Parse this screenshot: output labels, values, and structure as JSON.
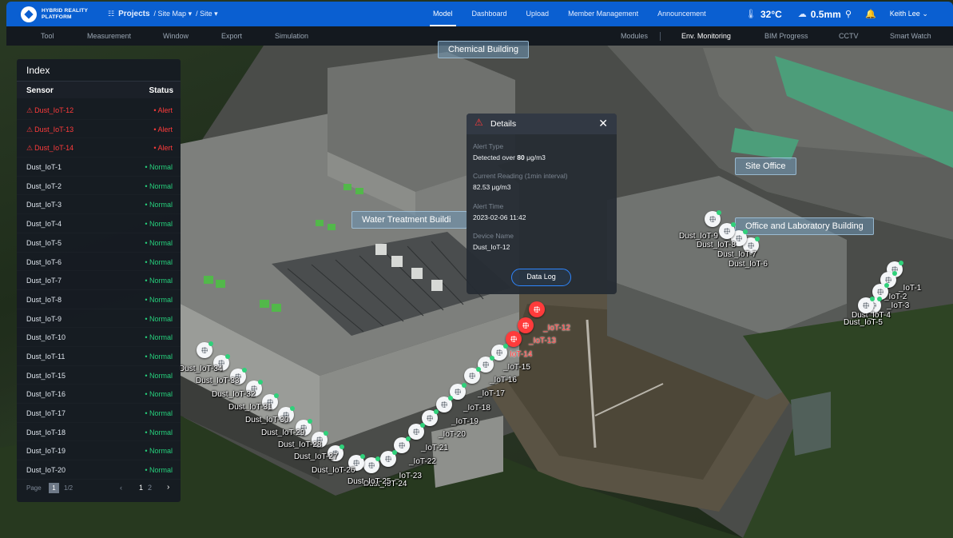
{
  "app": {
    "logo_line1": "HYBRID REALITY",
    "logo_line2": "PLATFORM",
    "logo_icon": "diamond-logo-icon"
  },
  "breadcrumb": {
    "projects": "Projects",
    "projects_icon": "grid-icon",
    "site_map": "/ Site Map ▾",
    "site": "/ Site ▾"
  },
  "topnav": [
    {
      "label": "Model",
      "active": true
    },
    {
      "label": "Dashboard",
      "active": false
    },
    {
      "label": "Upload",
      "active": false
    },
    {
      "label": "Member Management",
      "active": false
    },
    {
      "label": "Announcement",
      "active": false
    }
  ],
  "weather": {
    "temperature": "32°C",
    "temperature_icon": "thermometer-icon",
    "rainfall": "0.5mm",
    "rainfall_icon": "cloud-rain-icon"
  },
  "user": {
    "name": "Keith Lee",
    "search_icon": "search-icon",
    "bell_icon": "bell-icon",
    "chevron_icon": "chevron-down-icon"
  },
  "toolbar": {
    "left": [
      "Tool",
      "Measurement",
      "Window",
      "Export",
      "Simulation"
    ],
    "right": [
      {
        "label": "Modules",
        "active": false
      },
      {
        "label": "Env. Monitoring",
        "active": true
      },
      {
        "label": "BIM Progress",
        "active": false
      },
      {
        "label": "CCTV",
        "active": false
      },
      {
        "label": "Smart Watch",
        "active": false
      }
    ]
  },
  "index_panel": {
    "title": "Index",
    "col_sensor": "Sensor",
    "col_status": "Status",
    "rows": [
      {
        "sensor": "Dust_IoT-12",
        "status": "Alert",
        "alert": true
      },
      {
        "sensor": "Dust_IoT-13",
        "status": "Alert",
        "alert": true
      },
      {
        "sensor": "Dust_IoT-14",
        "status": "Alert",
        "alert": true
      },
      {
        "sensor": "Dust_IoT-1",
        "status": "Normal",
        "alert": false
      },
      {
        "sensor": "Dust_IoT-2",
        "status": "Normal",
        "alert": false
      },
      {
        "sensor": "Dust_IoT-3",
        "status": "Normal",
        "alert": false
      },
      {
        "sensor": "Dust_IoT-4",
        "status": "Normal",
        "alert": false
      },
      {
        "sensor": "Dust_IoT-5",
        "status": "Normal",
        "alert": false
      },
      {
        "sensor": "Dust_IoT-6",
        "status": "Normal",
        "alert": false
      },
      {
        "sensor": "Dust_IoT-7",
        "status": "Normal",
        "alert": false
      },
      {
        "sensor": "Dust_IoT-8",
        "status": "Normal",
        "alert": false
      },
      {
        "sensor": "Dust_IoT-9",
        "status": "Normal",
        "alert": false
      },
      {
        "sensor": "Dust_IoT-10",
        "status": "Normal",
        "alert": false
      },
      {
        "sensor": "Dust_IoT-11",
        "status": "Normal",
        "alert": false
      },
      {
        "sensor": "Dust_IoT-15",
        "status": "Normal",
        "alert": false
      },
      {
        "sensor": "Dust_IoT-16",
        "status": "Normal",
        "alert": false
      },
      {
        "sensor": "Dust_IoT-17",
        "status": "Normal",
        "alert": false
      },
      {
        "sensor": "Dust_IoT-18",
        "status": "Normal",
        "alert": false
      },
      {
        "sensor": "Dust_IoT-19",
        "status": "Normal",
        "alert": false
      },
      {
        "sensor": "Dust_IoT-20",
        "status": "Normal",
        "alert": false
      }
    ],
    "pager": {
      "label": "Page",
      "current": "1",
      "total": "1/2",
      "prev": "‹",
      "page1": "1",
      "page2": "2",
      "next": "›"
    }
  },
  "buildings": {
    "chemical": "Chemical Building",
    "water": "Water Treatment Buildi",
    "site_office": "Site Office",
    "office_lab": "Office and Laboratory Building"
  },
  "details": {
    "title": "Details",
    "warn_icon": "warning-triangle-icon",
    "close_icon": "close-icon",
    "alert_type_label": "Alert Type",
    "alert_type_prefix": "Detected over ",
    "alert_type_value": "80",
    "alert_type_unit": " μg/m3",
    "reading_label": "Current Reading (1min interval)",
    "reading_value": "82.53 μg/m3",
    "time_label": "Alert Time",
    "time_value": "2023-02-06 11:42",
    "device_label": "Device Name",
    "device_value": "Dust_IoT-12",
    "button": "Data Log"
  },
  "map_sensors": [
    {
      "label": "_IoT-12",
      "alert": true
    },
    {
      "label": "_IoT-13",
      "alert": true
    },
    {
      "label": "IoT-14",
      "alert": true
    },
    {
      "label": "_IoT-15",
      "alert": false
    },
    {
      "label": "_IoT-16",
      "alert": false
    },
    {
      "label": "_IoT-17",
      "alert": false
    },
    {
      "label": "_IoT-18",
      "alert": false
    },
    {
      "label": "_IoT-19",
      "alert": false
    },
    {
      "label": "_IoT-20",
      "alert": false
    },
    {
      "label": "_IoT-21",
      "alert": false
    },
    {
      "label": "_IoT-22",
      "alert": false
    },
    {
      "label": "_IoT-23",
      "alert": false
    },
    {
      "label": "Dust_IoT-24",
      "alert": false
    },
    {
      "label": "Dust_IoT-25",
      "alert": false
    },
    {
      "label": "Dust_IoT-26",
      "alert": false
    },
    {
      "label": "Dust_IoT-27",
      "alert": false
    },
    {
      "label": "Dust_IoT-28",
      "alert": false
    },
    {
      "label": "Dust_IoT-29",
      "alert": false
    },
    {
      "label": "Dust_IoT-30",
      "alert": false
    },
    {
      "label": "Dust_IoT-31",
      "alert": false
    },
    {
      "label": "Dust_IoT-32",
      "alert": false
    },
    {
      "label": "Dust_IoT-33",
      "alert": false
    },
    {
      "label": "Dust_IoT-34",
      "alert": false
    },
    {
      "label": "Dust_IoT-6",
      "alert": false
    },
    {
      "label": "Dust_IoT-7",
      "alert": false
    },
    {
      "label": "Dust_IoT-8",
      "alert": false
    },
    {
      "label": "Dust_IoT-9",
      "alert": false
    },
    {
      "label": "_IoT-1",
      "alert": false
    },
    {
      "label": "_IoT-2",
      "alert": false
    },
    {
      "label": "_IoT-3",
      "alert": false
    },
    {
      "label": "Dust_IoT-4",
      "alert": false
    },
    {
      "label": "Dust_IoT-5",
      "alert": false
    }
  ],
  "colors": {
    "brand": "#0a5fd1",
    "alert": "#ff3b3b",
    "normal": "#26d07c",
    "button_border": "#2e86ff"
  }
}
